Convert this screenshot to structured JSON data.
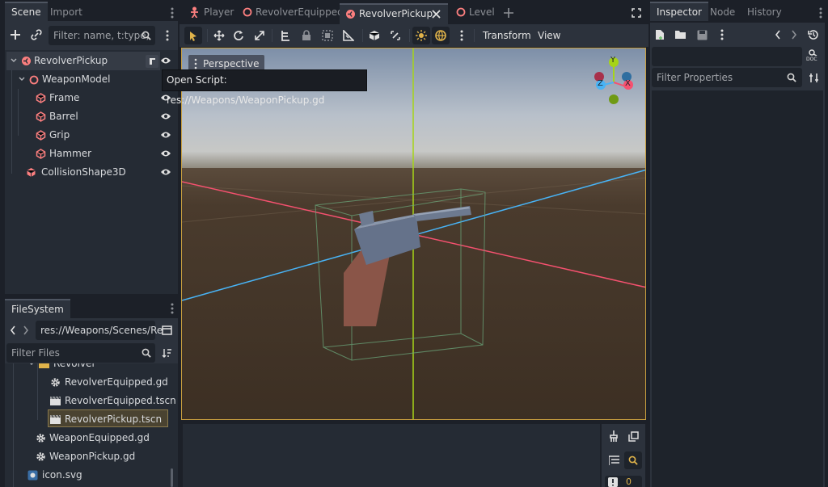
{
  "scene_dock": {
    "tabs": [
      "Scene",
      "Import"
    ],
    "filter_placeholder": "Filter: name, t:type,",
    "tree": [
      {
        "label": "RevolverPickup"
      },
      {
        "label": "WeaponModel"
      },
      {
        "label": "Frame"
      },
      {
        "label": "Barrel"
      },
      {
        "label": "Grip"
      },
      {
        "label": "Hammer"
      },
      {
        "label": "CollisionShape3D"
      }
    ],
    "tooltip": "Open Script: res://Weapons/WeaponPickup.gd"
  },
  "filesystem": {
    "tab": "FileSystem",
    "path": "res://Weapons/Scenes/Re",
    "filter_placeholder": "Filter Files",
    "items": [
      {
        "label": "Revolver"
      },
      {
        "label": "RevolverEquipped.gd"
      },
      {
        "label": "RevolverEquipped.tscn"
      },
      {
        "label": "RevolverPickup.tscn"
      },
      {
        "label": "WeaponEquipped.gd"
      },
      {
        "label": "WeaponPickup.gd"
      },
      {
        "label": "icon.svg"
      }
    ]
  },
  "editor_tabs": [
    {
      "label": "Player"
    },
    {
      "label": "RevolverEquipped"
    },
    {
      "label": "RevolverPickup"
    },
    {
      "label": "Level"
    }
  ],
  "toolbar": {
    "transform_label": "Transform",
    "view_label": "View"
  },
  "viewport": {
    "perspective_label": "Perspective",
    "gizmo": {
      "y": "Y",
      "z": "Z",
      "x": "X"
    }
  },
  "inspector": {
    "tabs": [
      "Inspector",
      "Node",
      "History"
    ],
    "filter_placeholder": "Filter Properties",
    "doc_label": "DOC"
  },
  "bottom_panel": {
    "counter": "0"
  },
  "colors": {
    "accent": "#e0b34a",
    "selection": "#4a4331",
    "node3d": "#fc7f7f",
    "x_axis": "#f5516f",
    "z_axis": "#48b3f5",
    "y_axis": "#a6d418"
  }
}
